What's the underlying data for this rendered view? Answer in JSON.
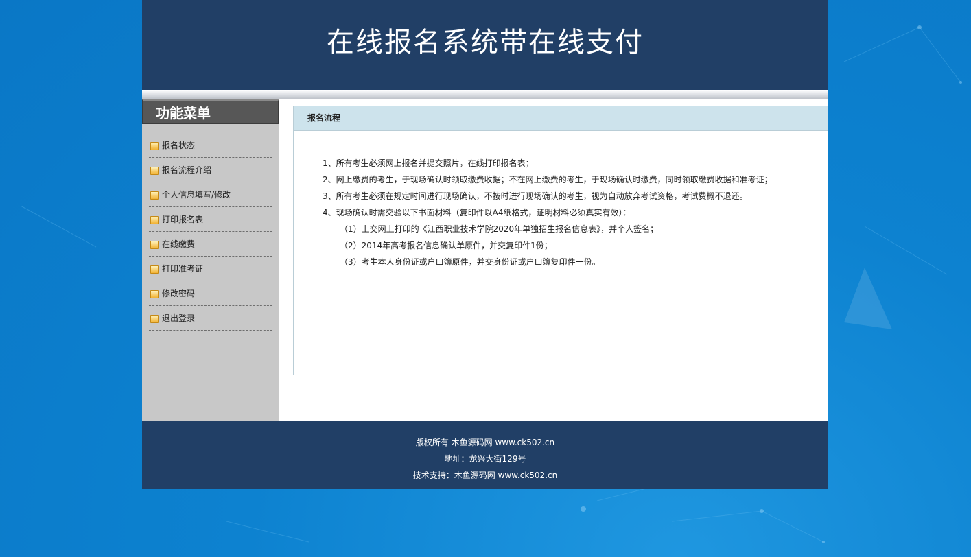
{
  "header": {
    "title": "在线报名系统带在线支付"
  },
  "sidebar": {
    "title": "功能菜单",
    "items": [
      {
        "label": "报名状态"
      },
      {
        "label": "报名流程介绍"
      },
      {
        "label": "个人信息填写/修改"
      },
      {
        "label": "打印报名表"
      },
      {
        "label": "在线缴费"
      },
      {
        "label": "打印准考证"
      },
      {
        "label": "修改密码"
      },
      {
        "label": "退出登录"
      }
    ]
  },
  "panel": {
    "title": "报名流程",
    "steps": [
      "1、所有考生必须网上报名并提交照片，在线打印报名表；",
      "2、网上缴费的考生，于现场确认时领取缴费收据；不在网上缴费的考生，于现场确认时缴费，同时领取缴费收据和准考证；",
      "3、所有考生必须在规定时间进行现场确认，不按时进行现场确认的考生，视为自动放弃考试资格，考试费概不退还。",
      "4、现场确认时需交验以下书面材料（复印件以A4纸格式，证明材料必须真实有效）：",
      "（1）上交网上打印的《江西职业技术学院2020年单独招生报名信息表》，并个人签名；",
      "（2）2014年高考报名信息确认单原件，并交复印件1份；",
      "（3）考生本人身份证或户口簿原件，并交身份证或户口簿复印件一份。"
    ]
  },
  "footer": {
    "copyright": "版权所有 木鱼源码网 www.ck502.cn",
    "address": "地址：龙兴大街129号",
    "support": "技术支持：木鱼源码网 www.ck502.cn"
  },
  "colors": {
    "background": "#0a7fcf",
    "header": "#213f66",
    "sidebar": "#c8c8c8",
    "panel_header": "#cde3ec"
  }
}
